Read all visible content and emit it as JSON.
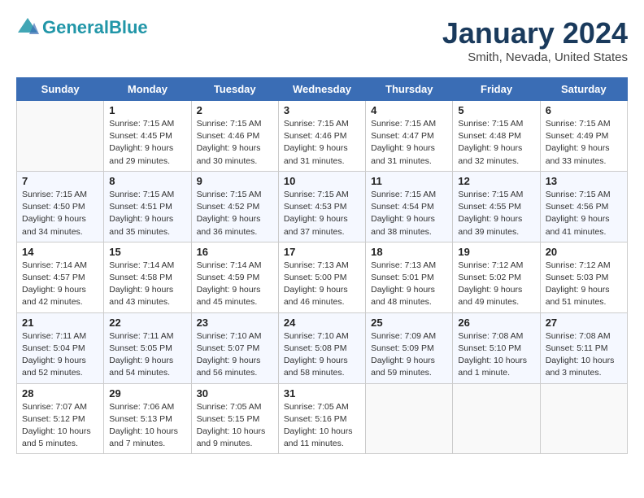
{
  "header": {
    "logo_line1": "General",
    "logo_line2": "Blue",
    "month": "January 2024",
    "location": "Smith, Nevada, United States"
  },
  "columns": [
    "Sunday",
    "Monday",
    "Tuesday",
    "Wednesday",
    "Thursday",
    "Friday",
    "Saturday"
  ],
  "weeks": [
    [
      {
        "day": "",
        "info": ""
      },
      {
        "day": "1",
        "info": "Sunrise: 7:15 AM\nSunset: 4:45 PM\nDaylight: 9 hours\nand 29 minutes."
      },
      {
        "day": "2",
        "info": "Sunrise: 7:15 AM\nSunset: 4:46 PM\nDaylight: 9 hours\nand 30 minutes."
      },
      {
        "day": "3",
        "info": "Sunrise: 7:15 AM\nSunset: 4:46 PM\nDaylight: 9 hours\nand 31 minutes."
      },
      {
        "day": "4",
        "info": "Sunrise: 7:15 AM\nSunset: 4:47 PM\nDaylight: 9 hours\nand 31 minutes."
      },
      {
        "day": "5",
        "info": "Sunrise: 7:15 AM\nSunset: 4:48 PM\nDaylight: 9 hours\nand 32 minutes."
      },
      {
        "day": "6",
        "info": "Sunrise: 7:15 AM\nSunset: 4:49 PM\nDaylight: 9 hours\nand 33 minutes."
      }
    ],
    [
      {
        "day": "7",
        "info": "Sunrise: 7:15 AM\nSunset: 4:50 PM\nDaylight: 9 hours\nand 34 minutes."
      },
      {
        "day": "8",
        "info": "Sunrise: 7:15 AM\nSunset: 4:51 PM\nDaylight: 9 hours\nand 35 minutes."
      },
      {
        "day": "9",
        "info": "Sunrise: 7:15 AM\nSunset: 4:52 PM\nDaylight: 9 hours\nand 36 minutes."
      },
      {
        "day": "10",
        "info": "Sunrise: 7:15 AM\nSunset: 4:53 PM\nDaylight: 9 hours\nand 37 minutes."
      },
      {
        "day": "11",
        "info": "Sunrise: 7:15 AM\nSunset: 4:54 PM\nDaylight: 9 hours\nand 38 minutes."
      },
      {
        "day": "12",
        "info": "Sunrise: 7:15 AM\nSunset: 4:55 PM\nDaylight: 9 hours\nand 39 minutes."
      },
      {
        "day": "13",
        "info": "Sunrise: 7:15 AM\nSunset: 4:56 PM\nDaylight: 9 hours\nand 41 minutes."
      }
    ],
    [
      {
        "day": "14",
        "info": "Sunrise: 7:14 AM\nSunset: 4:57 PM\nDaylight: 9 hours\nand 42 minutes."
      },
      {
        "day": "15",
        "info": "Sunrise: 7:14 AM\nSunset: 4:58 PM\nDaylight: 9 hours\nand 43 minutes."
      },
      {
        "day": "16",
        "info": "Sunrise: 7:14 AM\nSunset: 4:59 PM\nDaylight: 9 hours\nand 45 minutes."
      },
      {
        "day": "17",
        "info": "Sunrise: 7:13 AM\nSunset: 5:00 PM\nDaylight: 9 hours\nand 46 minutes."
      },
      {
        "day": "18",
        "info": "Sunrise: 7:13 AM\nSunset: 5:01 PM\nDaylight: 9 hours\nand 48 minutes."
      },
      {
        "day": "19",
        "info": "Sunrise: 7:12 AM\nSunset: 5:02 PM\nDaylight: 9 hours\nand 49 minutes."
      },
      {
        "day": "20",
        "info": "Sunrise: 7:12 AM\nSunset: 5:03 PM\nDaylight: 9 hours\nand 51 minutes."
      }
    ],
    [
      {
        "day": "21",
        "info": "Sunrise: 7:11 AM\nSunset: 5:04 PM\nDaylight: 9 hours\nand 52 minutes."
      },
      {
        "day": "22",
        "info": "Sunrise: 7:11 AM\nSunset: 5:05 PM\nDaylight: 9 hours\nand 54 minutes."
      },
      {
        "day": "23",
        "info": "Sunrise: 7:10 AM\nSunset: 5:07 PM\nDaylight: 9 hours\nand 56 minutes."
      },
      {
        "day": "24",
        "info": "Sunrise: 7:10 AM\nSunset: 5:08 PM\nDaylight: 9 hours\nand 58 minutes."
      },
      {
        "day": "25",
        "info": "Sunrise: 7:09 AM\nSunset: 5:09 PM\nDaylight: 9 hours\nand 59 minutes."
      },
      {
        "day": "26",
        "info": "Sunrise: 7:08 AM\nSunset: 5:10 PM\nDaylight: 10 hours\nand 1 minute."
      },
      {
        "day": "27",
        "info": "Sunrise: 7:08 AM\nSunset: 5:11 PM\nDaylight: 10 hours\nand 3 minutes."
      }
    ],
    [
      {
        "day": "28",
        "info": "Sunrise: 7:07 AM\nSunset: 5:12 PM\nDaylight: 10 hours\nand 5 minutes."
      },
      {
        "day": "29",
        "info": "Sunrise: 7:06 AM\nSunset: 5:13 PM\nDaylight: 10 hours\nand 7 minutes."
      },
      {
        "day": "30",
        "info": "Sunrise: 7:05 AM\nSunset: 5:15 PM\nDaylight: 10 hours\nand 9 minutes."
      },
      {
        "day": "31",
        "info": "Sunrise: 7:05 AM\nSunset: 5:16 PM\nDaylight: 10 hours\nand 11 minutes."
      },
      {
        "day": "",
        "info": ""
      },
      {
        "day": "",
        "info": ""
      },
      {
        "day": "",
        "info": ""
      }
    ]
  ]
}
